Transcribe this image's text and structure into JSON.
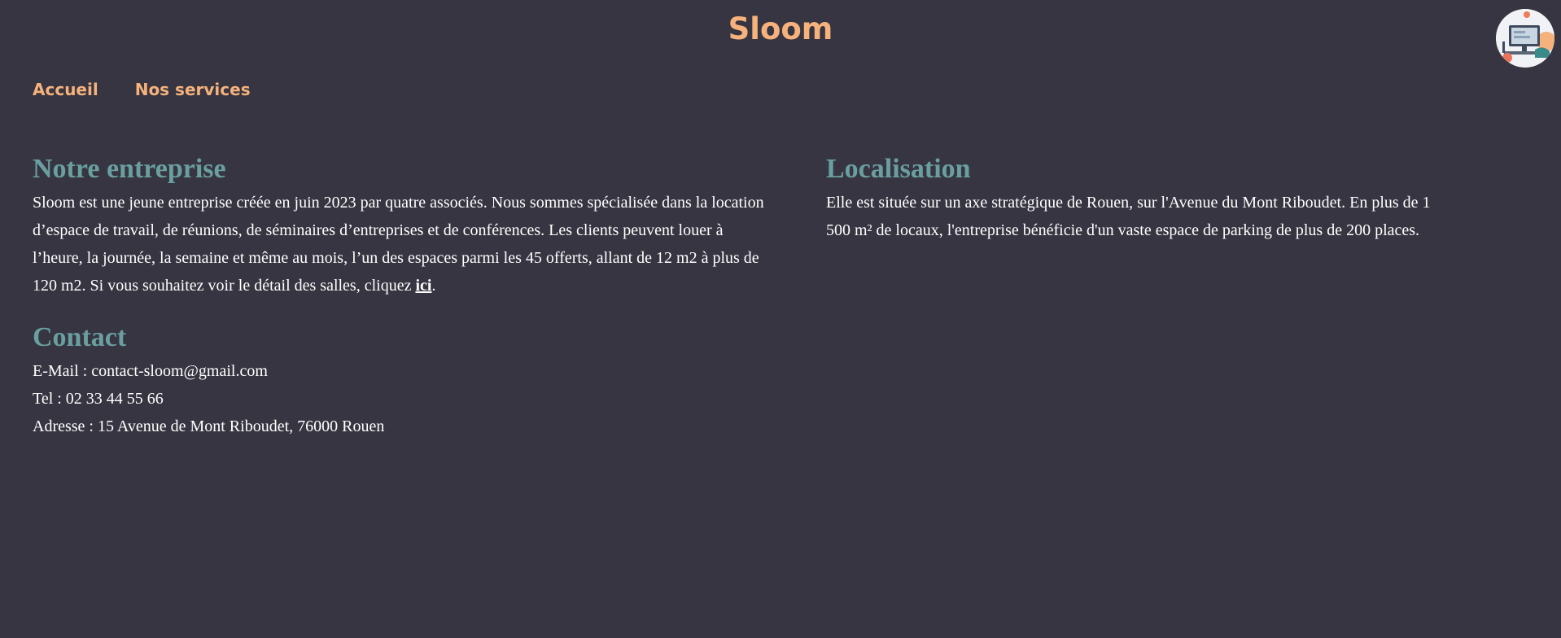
{
  "header": {
    "title": "Sloom"
  },
  "nav": {
    "items": [
      {
        "label": "Accueil"
      },
      {
        "label": "Nos services"
      }
    ]
  },
  "entreprise": {
    "heading": "Notre entreprise",
    "text": "Sloom est une jeune entreprise créée en juin 2023 par quatre associés. Nous sommes spécialisée dans la location d’espace de travail, de réunions, de séminaires d’entreprises et de conférences. Les clients peuvent louer à l’heure, la journée, la semaine et même au mois, l’un des espaces parmi les 45 offerts, allant de 12 m2 à plus de 120 m2. Si vous souhaitez voir le détail des salles, cliquez ",
    "link_label": "ici",
    "text_end": "."
  },
  "localisation": {
    "heading": "Localisation",
    "text": "Elle est située sur un axe stratégique de Rouen, sur l'Avenue du Mont Riboudet. En plus de 1 500 m² de locaux, l'entreprise bénéficie d'un vaste espace de parking de plus de 200 places."
  },
  "contact": {
    "heading": "Contact",
    "email": "E-Mail : contact-sloom@gmail.com",
    "tel": "Tel : 02 33 44 55 66",
    "address": "Adresse : 15 Avenue de Mont Riboudet, 76000 Rouen"
  },
  "colors": {
    "background": "#373541",
    "accent": "#f5b27c",
    "heading": "#6a9fa0",
    "text": "#ffffff"
  },
  "icons": {
    "avatar": "workspace-illustration-icon"
  }
}
